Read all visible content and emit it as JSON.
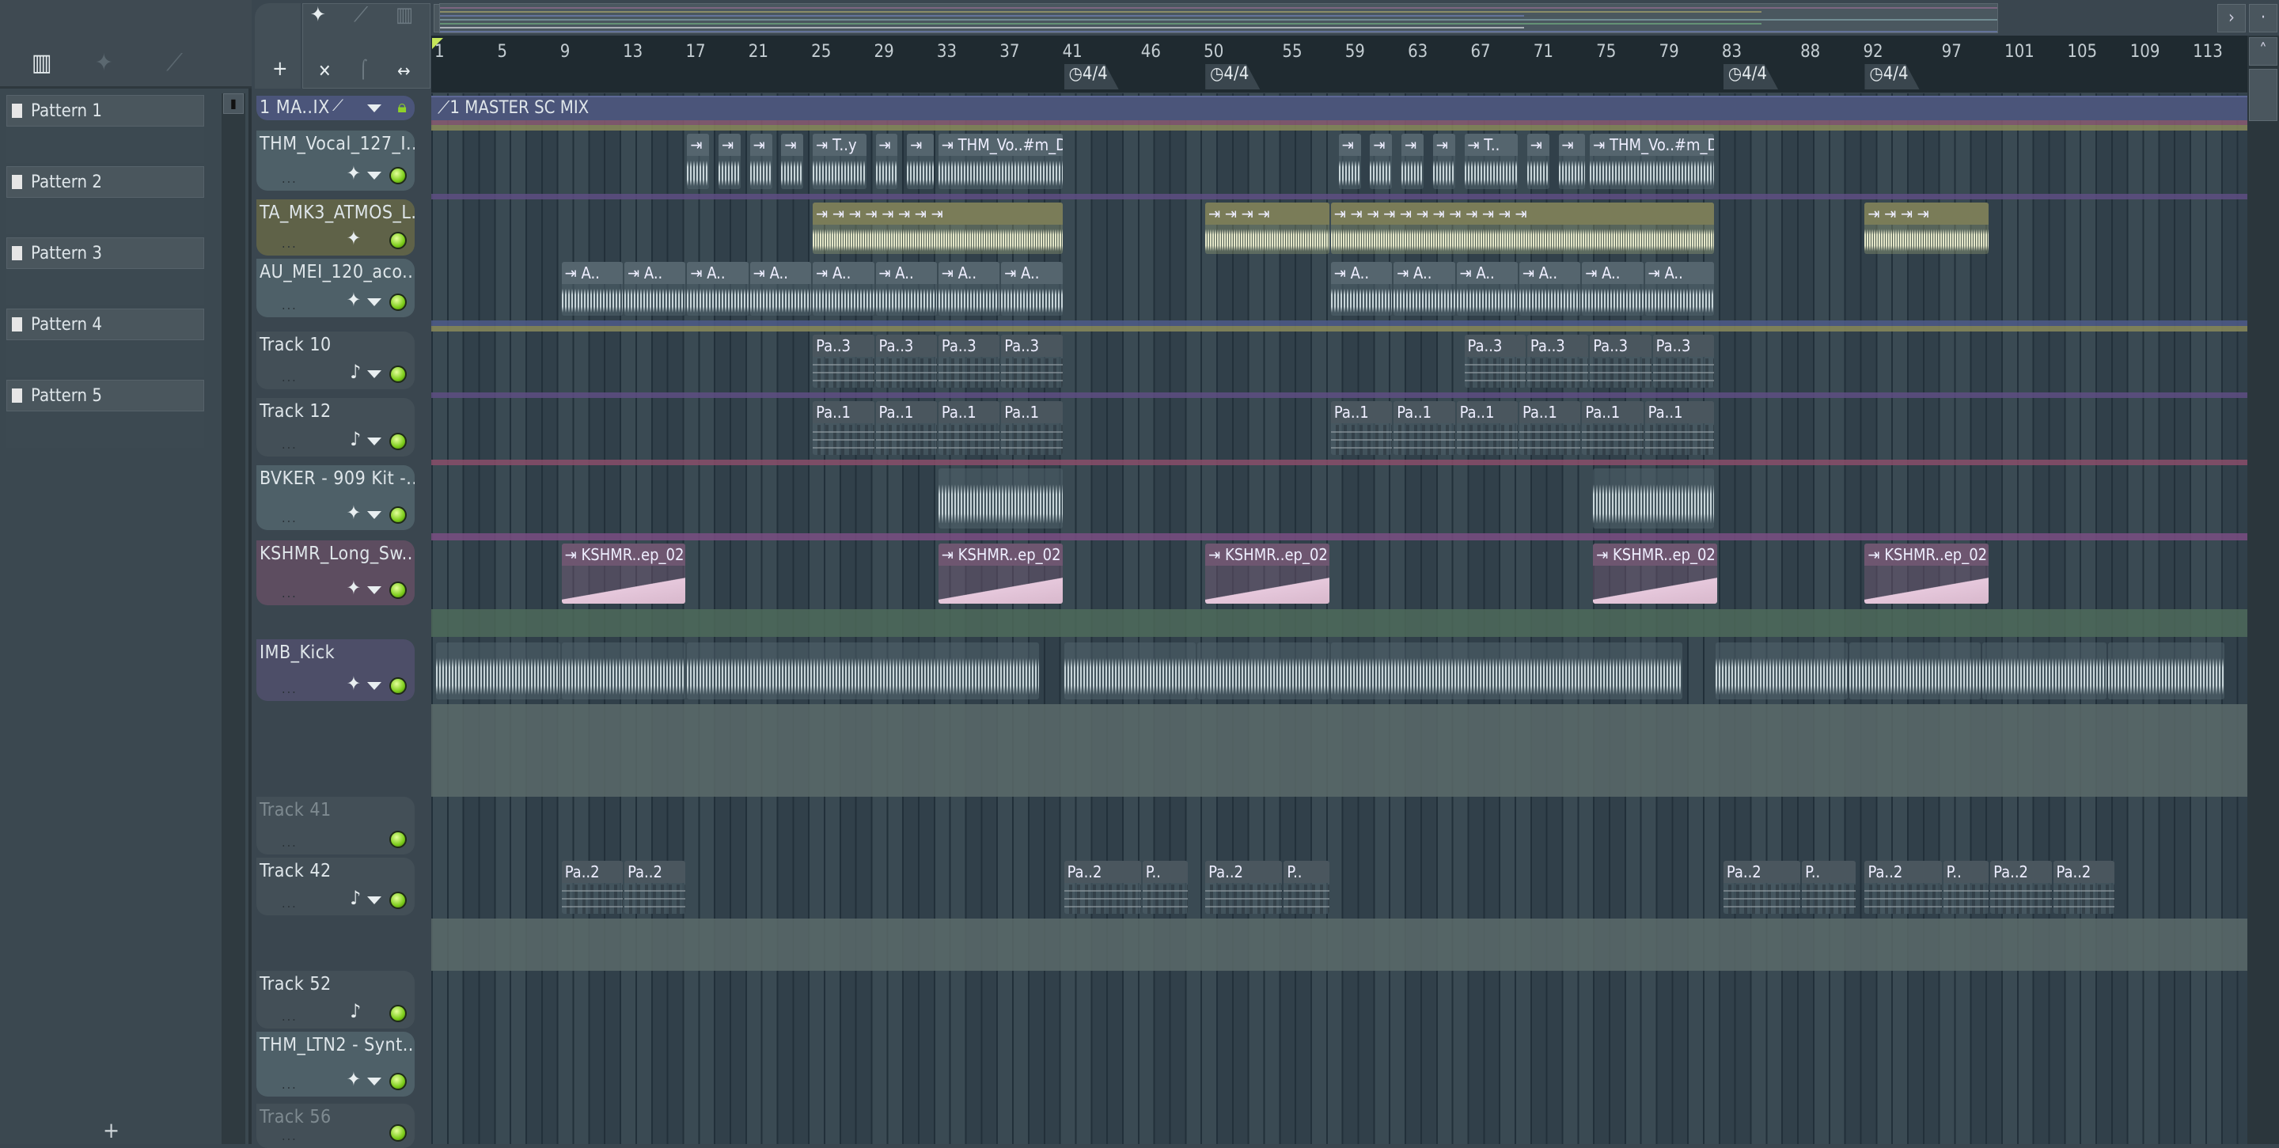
{
  "left_panel": {
    "tabs": [
      {
        "icon": "piano-roll-icon",
        "active": true
      },
      {
        "icon": "audio-wave-icon",
        "active": false
      },
      {
        "icon": "automation-icon",
        "active": false
      }
    ],
    "patterns": [
      "Pattern 1",
      "Pattern 2",
      "Pattern 3",
      "Pattern 4",
      "Pattern 5"
    ],
    "add_label": "+"
  },
  "toolbar": {
    "plus": "+",
    "cut": "✕",
    "curve": "⌠",
    "stretch": "↔"
  },
  "ruler": {
    "bars": [
      1,
      5,
      9,
      13,
      17,
      21,
      25,
      29,
      33,
      37,
      41,
      46,
      50,
      55,
      59,
      63,
      67,
      71,
      75,
      79,
      83,
      88,
      92,
      97,
      101,
      105,
      109,
      113
    ],
    "time_signatures": [
      {
        "bar": 41,
        "label": "4/4"
      },
      {
        "bar": 50,
        "label": "4/4"
      },
      {
        "bar": 83,
        "label": "4/4"
      },
      {
        "bar": 92,
        "label": "4/4"
      }
    ]
  },
  "master": {
    "header": "1 MA..IX",
    "clip_label": "1 MASTER SC MIX",
    "color": "#4b557a"
  },
  "tracks": [
    {
      "name": "THM_Vocal_127_I..",
      "icon": "wave",
      "color": "#4e6068"
    },
    {
      "name": "TA_MK3_ATMOS_L..",
      "icon": "wave",
      "color": "#5f6248",
      "nodd": true
    },
    {
      "name": "AU_MEI_120_aco..",
      "icon": "wave",
      "color": "#4e6068"
    },
    {
      "name": "Track 10",
      "icon": "note",
      "color": "#434f57"
    },
    {
      "name": "Track 12",
      "icon": "note",
      "color": "#434f57"
    },
    {
      "name": "BVKER - 909 Kit -..",
      "icon": "wave",
      "color": "#4e6068"
    },
    {
      "name": "KSHMR_Long_Sw..",
      "icon": "wave",
      "color": "#5d4d60"
    },
    {
      "name": "IMB_Kick",
      "icon": "wave",
      "color": "#4d4e68"
    },
    {
      "name": "Track 41",
      "icon": "none",
      "color": "#434f57",
      "dim": true
    },
    {
      "name": "Track 42",
      "icon": "note",
      "color": "#434f57"
    },
    {
      "name": "Track 52",
      "icon": "note",
      "color": "#434f57",
      "nodd": true
    },
    {
      "name": "THM_LTN2 - Synt..",
      "icon": "wave",
      "color": "#4e6068"
    },
    {
      "name": "Track 56",
      "icon": "none",
      "color": "#434f57",
      "dim": true
    }
  ],
  "clips": [
    {
      "t": 0,
      "s": 17,
      "l": 1.5,
      "label": "⇥",
      "k": "wave"
    },
    {
      "t": 0,
      "s": 19,
      "l": 1.5,
      "label": "⇥",
      "k": "wave"
    },
    {
      "t": 0,
      "s": 21,
      "l": 1.5,
      "label": "⇥",
      "k": "wave"
    },
    {
      "t": 0,
      "s": 23,
      "l": 1.5,
      "label": "⇥",
      "k": "wave"
    },
    {
      "t": 0,
      "s": 25,
      "l": 3.5,
      "label": "⇥ T..y",
      "k": "wave"
    },
    {
      "t": 0,
      "s": 29,
      "l": 1.5,
      "label": "⇥",
      "k": "wave"
    },
    {
      "t": 0,
      "s": 31,
      "l": 1.8,
      "label": "⇥",
      "k": "wave"
    },
    {
      "t": 0,
      "s": 33,
      "l": 8,
      "label": "⇥ THM_Vo..#m_Dry",
      "k": "wave"
    },
    {
      "t": 0,
      "s": 58.5,
      "l": 1.5,
      "label": "⇥",
      "k": "wave"
    },
    {
      "t": 0,
      "s": 60.5,
      "l": 1.5,
      "label": "⇥",
      "k": "wave"
    },
    {
      "t": 0,
      "s": 62.5,
      "l": 1.5,
      "label": "⇥",
      "k": "wave"
    },
    {
      "t": 0,
      "s": 64.5,
      "l": 1.5,
      "label": "⇥",
      "k": "wave"
    },
    {
      "t": 0,
      "s": 66.5,
      "l": 3.5,
      "label": "⇥ T..",
      "k": "wave"
    },
    {
      "t": 0,
      "s": 70.5,
      "l": 1.5,
      "label": "⇥",
      "k": "wave"
    },
    {
      "t": 0,
      "s": 72.5,
      "l": 1.8,
      "label": "⇥",
      "k": "wave"
    },
    {
      "t": 0,
      "s": 74.5,
      "l": 8,
      "label": "⇥ THM_Vo..#m_Dry",
      "k": "wave"
    },
    {
      "t": 1,
      "s": 25,
      "l": 16,
      "label": "⇥ ⇥ ⇥ ⇥ ⇥ ⇥ ⇥ ⇥",
      "k": "atmos"
    },
    {
      "t": 1,
      "s": 50,
      "l": 8,
      "label": "⇥ ⇥ ⇥ ⇥",
      "k": "atmos"
    },
    {
      "t": 1,
      "s": 58,
      "l": 24.5,
      "label": "⇥ ⇥ ⇥ ⇥ ⇥ ⇥ ⇥ ⇥ ⇥ ⇥ ⇥ ⇥",
      "k": "atmos"
    },
    {
      "t": 1,
      "s": 92,
      "l": 8,
      "label": "⇥ ⇥ ⇥ ⇥",
      "k": "atmos"
    },
    {
      "t": 2,
      "s": 9,
      "l": 4,
      "label": "⇥ A..",
      "k": "wave"
    },
    {
      "t": 2,
      "s": 13,
      "l": 4,
      "label": "⇥ A..",
      "k": "wave"
    },
    {
      "t": 2,
      "s": 17,
      "l": 4,
      "label": "⇥ A..",
      "k": "wave"
    },
    {
      "t": 2,
      "s": 21,
      "l": 4,
      "label": "⇥ A..",
      "k": "wave"
    },
    {
      "t": 2,
      "s": 25,
      "l": 4,
      "label": "⇥ A..",
      "k": "wave"
    },
    {
      "t": 2,
      "s": 29,
      "l": 4,
      "label": "⇥ A..",
      "k": "wave"
    },
    {
      "t": 2,
      "s": 33,
      "l": 4,
      "label": "⇥ A..",
      "k": "wave"
    },
    {
      "t": 2,
      "s": 37,
      "l": 4,
      "label": "⇥ A..",
      "k": "wave"
    },
    {
      "t": 2,
      "s": 58,
      "l": 4,
      "label": "⇥ A..",
      "k": "wave"
    },
    {
      "t": 2,
      "s": 62,
      "l": 4,
      "label": "⇥ A..",
      "k": "wave"
    },
    {
      "t": 2,
      "s": 66,
      "l": 4,
      "label": "⇥ A..",
      "k": "wave"
    },
    {
      "t": 2,
      "s": 70,
      "l": 4,
      "label": "⇥ A..",
      "k": "wave"
    },
    {
      "t": 2,
      "s": 74,
      "l": 4,
      "label": "⇥ A..",
      "k": "wave"
    },
    {
      "t": 2,
      "s": 78,
      "l": 4.5,
      "label": "⇥ A..",
      "k": "wave"
    },
    {
      "t": 3,
      "s": 25,
      "l": 4,
      "label": "Pa..3",
      "k": "notes"
    },
    {
      "t": 3,
      "s": 29,
      "l": 4,
      "label": "Pa..3",
      "k": "notes"
    },
    {
      "t": 3,
      "s": 33,
      "l": 4,
      "label": "Pa..3",
      "k": "notes"
    },
    {
      "t": 3,
      "s": 37,
      "l": 4,
      "label": "Pa..3",
      "k": "notes"
    },
    {
      "t": 3,
      "s": 66.5,
      "l": 4,
      "label": "Pa..3",
      "k": "notes"
    },
    {
      "t": 3,
      "s": 70.5,
      "l": 4,
      "label": "Pa..3",
      "k": "notes"
    },
    {
      "t": 3,
      "s": 74.5,
      "l": 4,
      "label": "Pa..3",
      "k": "notes"
    },
    {
      "t": 3,
      "s": 78.5,
      "l": 4,
      "label": "Pa..3",
      "k": "notes"
    },
    {
      "t": 4,
      "s": 25,
      "l": 4,
      "label": "Pa..1",
      "k": "notes"
    },
    {
      "t": 4,
      "s": 29,
      "l": 4,
      "label": "Pa..1",
      "k": "notes"
    },
    {
      "t": 4,
      "s": 33,
      "l": 4,
      "label": "Pa..1",
      "k": "notes"
    },
    {
      "t": 4,
      "s": 37,
      "l": 4,
      "label": "Pa..1",
      "k": "notes"
    },
    {
      "t": 4,
      "s": 58,
      "l": 4,
      "label": "Pa..1",
      "k": "notes"
    },
    {
      "t": 4,
      "s": 62,
      "l": 4,
      "label": "Pa..1",
      "k": "notes"
    },
    {
      "t": 4,
      "s": 66,
      "l": 4,
      "label": "Pa..1",
      "k": "notes"
    },
    {
      "t": 4,
      "s": 70,
      "l": 4,
      "label": "Pa..1",
      "k": "notes"
    },
    {
      "t": 4,
      "s": 74,
      "l": 4,
      "label": "Pa..1",
      "k": "notes"
    },
    {
      "t": 4,
      "s": 78,
      "l": 4.5,
      "label": "Pa..1",
      "k": "notes"
    },
    {
      "t": 5,
      "s": 33,
      "l": 8,
      "label": "",
      "k": "wave"
    },
    {
      "t": 5,
      "s": 74.7,
      "l": 7.8,
      "label": "",
      "k": "wave"
    },
    {
      "t": 6,
      "s": 9,
      "l": 8,
      "label": "⇥ KSHMR..ep_02",
      "k": "sweep"
    },
    {
      "t": 6,
      "s": 33,
      "l": 8,
      "label": "⇥ KSHMR..ep_02",
      "k": "sweep"
    },
    {
      "t": 6,
      "s": 50,
      "l": 8,
      "label": "⇥ KSHMR..ep_02",
      "k": "sweep"
    },
    {
      "t": 6,
      "s": 74.7,
      "l": 8,
      "label": "⇥ KSHMR..ep_02",
      "k": "sweep"
    },
    {
      "t": 6,
      "s": 92,
      "l": 8,
      "label": "⇥ KSHMR..ep_02",
      "k": "sweep"
    },
    {
      "t": 7,
      "s": 1,
      "l": 8,
      "label": "",
      "k": "wave"
    },
    {
      "t": 7,
      "s": 9,
      "l": 8,
      "label": "",
      "k": "wave"
    },
    {
      "t": 7,
      "s": 17,
      "l": 22.5,
      "label": "",
      "k": "wave"
    },
    {
      "t": 7,
      "s": 41,
      "l": 8.5,
      "label": "",
      "k": "wave"
    },
    {
      "t": 7,
      "s": 49.5,
      "l": 8.5,
      "label": "",
      "k": "wave"
    },
    {
      "t": 7,
      "s": 58,
      "l": 22.5,
      "label": "",
      "k": "wave"
    },
    {
      "t": 7,
      "s": 82.5,
      "l": 8.5,
      "label": "",
      "k": "wave"
    },
    {
      "t": 7,
      "s": 91,
      "l": 8.5,
      "label": "",
      "k": "wave"
    },
    {
      "t": 7,
      "s": 99.5,
      "l": 8,
      "label": "",
      "k": "wave"
    },
    {
      "t": 7,
      "s": 107.5,
      "l": 7.5,
      "label": "",
      "k": "wave"
    },
    {
      "t": 9,
      "s": 9,
      "l": 4,
      "label": "Pa..2",
      "k": "notes"
    },
    {
      "t": 9,
      "s": 13,
      "l": 4,
      "label": "Pa..2",
      "k": "notes"
    },
    {
      "t": 9,
      "s": 41,
      "l": 5,
      "label": "Pa..2",
      "k": "notes"
    },
    {
      "t": 9,
      "s": 46,
      "l": 3,
      "label": "P..",
      "k": "notes"
    },
    {
      "t": 9,
      "s": 50,
      "l": 5,
      "label": "Pa..2",
      "k": "notes"
    },
    {
      "t": 9,
      "s": 55,
      "l": 3,
      "label": "P..",
      "k": "notes"
    },
    {
      "t": 9,
      "s": 83,
      "l": 5,
      "label": "Pa..2",
      "k": "notes"
    },
    {
      "t": 9,
      "s": 88,
      "l": 3.5,
      "label": "P..",
      "k": "notes"
    },
    {
      "t": 9,
      "s": 92,
      "l": 5,
      "label": "Pa..2",
      "k": "notes"
    },
    {
      "t": 9,
      "s": 97,
      "l": 3,
      "label": "P..",
      "k": "notes"
    },
    {
      "t": 9,
      "s": 100,
      "l": 4,
      "label": "Pa..2",
      "k": "notes"
    },
    {
      "t": 9,
      "s": 104,
      "l": 4,
      "label": "Pa..2",
      "k": "notes"
    }
  ]
}
